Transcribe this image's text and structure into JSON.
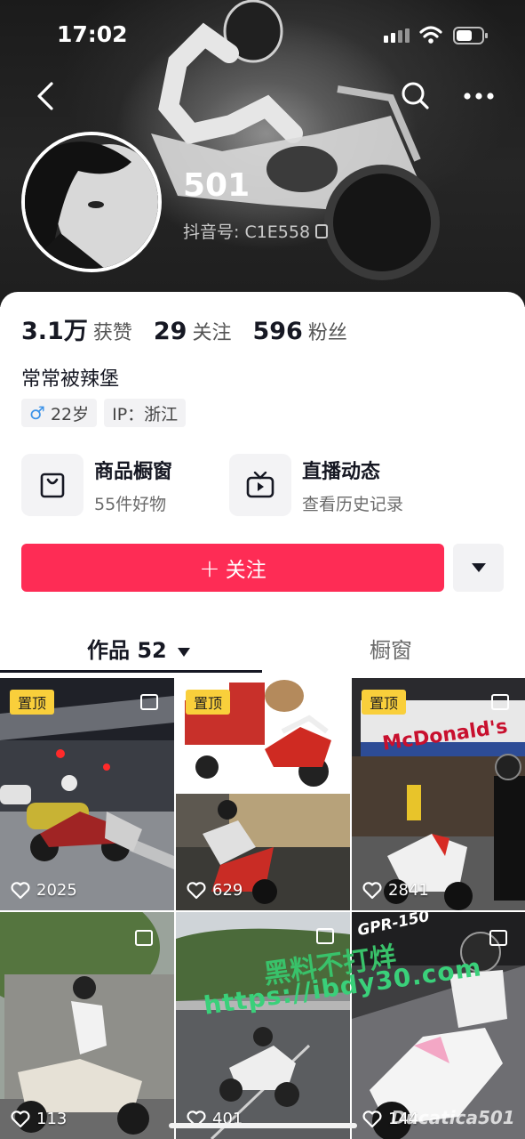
{
  "status_bar": {
    "time": "17:02"
  },
  "profile": {
    "nickname": "501",
    "douyin_id": "抖音号: C1E558",
    "stats": [
      {
        "num": "3.1万",
        "label": "获赞"
      },
      {
        "num": "29",
        "label": "关注"
      },
      {
        "num": "596",
        "label": "粉丝"
      }
    ],
    "bio": "常常被辣堡",
    "tags": {
      "gender_symbol": "♂",
      "age": "22岁",
      "ip": "IP：浙江"
    }
  },
  "features": {
    "shop": {
      "title": "商品橱窗",
      "sub": "55件好物",
      "icon": "shopping-bag-icon"
    },
    "live": {
      "title": "直播动态",
      "sub": "查看历史记录",
      "icon": "tv-icon"
    }
  },
  "actions": {
    "follow_label": "关注",
    "follow_symbol": "+"
  },
  "tabs": {
    "works": "作品 52",
    "window": "橱窗"
  },
  "videos": [
    {
      "pinned": "置顶",
      "likes": "2025"
    },
    {
      "pinned": "置顶",
      "likes": "629"
    },
    {
      "pinned": "置顶",
      "likes": "2841"
    },
    {
      "likes": "113"
    },
    {
      "likes": "401"
    },
    {
      "likes": "144"
    }
  ],
  "overlays": {
    "watermark_cn": "黑料不打烊",
    "watermark_url": "https://ibdy30.com",
    "tile_watermark": "Ducatica501",
    "tile_caption": "GPR-150",
    "storefront_sign": "McDonald's"
  },
  "colors": {
    "accent": "#fe2c55",
    "pin": "#f9cf3b",
    "male": "#3c93e8"
  }
}
